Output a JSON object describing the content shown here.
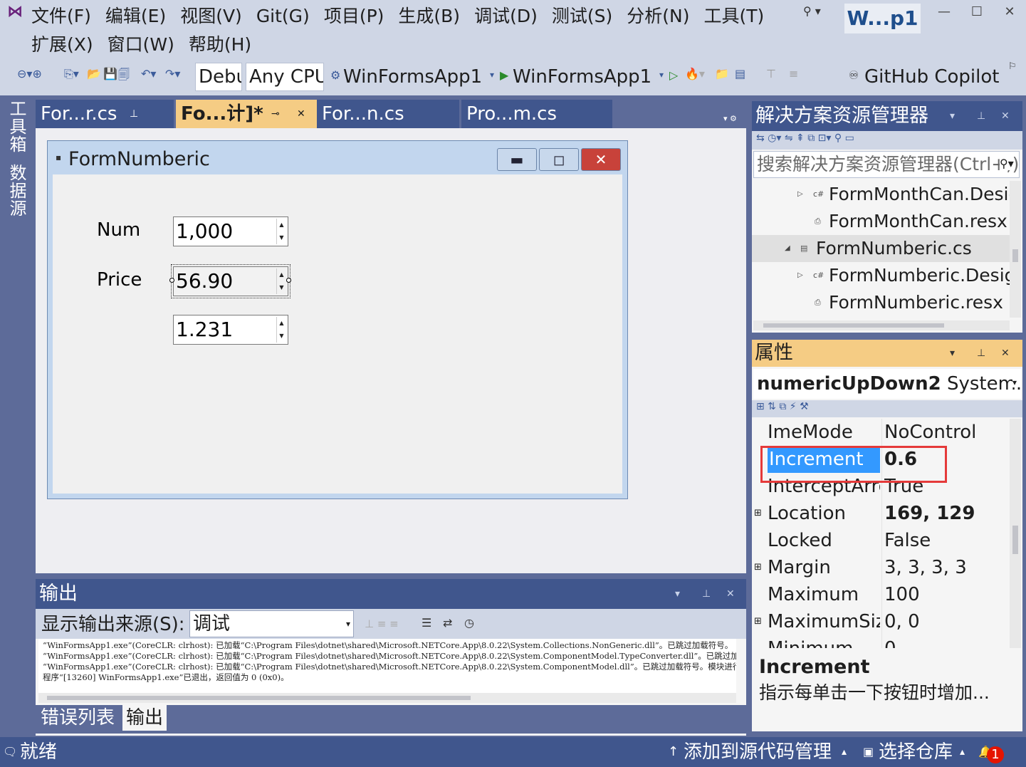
{
  "window": {
    "title": "W...p1",
    "minimize": "—",
    "maximize": "☐",
    "close": "✕"
  },
  "menu": {
    "row1": [
      "文件(F)",
      "编辑(E)",
      "视图(V)",
      "Git(G)",
      "项目(P)",
      "生成(B)",
      "调试(D)",
      "测试(S)",
      "分析(N)",
      "工具(T)"
    ],
    "row2": [
      "扩展(X)",
      "窗口(W)",
      "帮助(H)"
    ]
  },
  "toolbar": {
    "config": "Debug",
    "platform": "Any CPU",
    "startup_project": "WinFormsApp1",
    "run_target": "WinFormsApp1",
    "copilot": "GitHub Copilot"
  },
  "left_strip": {
    "toolbox": "工具箱",
    "datasource": "数据源"
  },
  "doc_tabs": [
    {
      "label": "For...r.cs",
      "active": false
    },
    {
      "label": "Fo...计]*",
      "active": true
    },
    {
      "label": "For...n.cs",
      "active": false
    },
    {
      "label": "Pro...m.cs",
      "active": false
    }
  ],
  "designer_form": {
    "title": "FormNumberic",
    "labels": {
      "num": "Num",
      "price": "Price"
    },
    "nud1": "1,000",
    "nud2": "56.90",
    "nud3": "1.231"
  },
  "output": {
    "title": "输出",
    "source_label": "显示输出来源(S):",
    "source_value": "调试",
    "lines": [
      "“WinFormsApp1.exe”(CoreCLR: clrhost): 已加载“C:\\Program Files\\dotnet\\shared\\Microsoft.NETCore.App\\8.0.22\\System.Collections.NonGeneric.dll”。已跳过加载符号。",
      "“WinFormsApp1.exe”(CoreCLR: clrhost): 已加载“C:\\Program Files\\dotnet\\shared\\Microsoft.NETCore.App\\8.0.22\\System.ComponentModel.TypeConverter.dll”。已跳过加载",
      "“WinFormsApp1.exe”(CoreCLR: clrhost): 已加载“C:\\Program Files\\dotnet\\shared\\Microsoft.NETCore.App\\8.0.22\\System.ComponentModel.dll”。已跳过加载符号。模块进行",
      "程序“[13260] WinFormsApp1.exe”已退出，返回值为 0 (0x0)。"
    ],
    "tabs": {
      "errors": "错误列表",
      "output": "输出"
    }
  },
  "solution_explorer": {
    "title": "解决方案资源管理器",
    "search_placeholder": "搜索解决方案资源管理器(Ctrl+;)",
    "items": [
      {
        "label": "FormMonthCan.Designer.cs",
        "icon": "C#"
      },
      {
        "label": "FormMonthCan.resx",
        "icon": "resx"
      },
      {
        "label": "FormNumberic.cs",
        "icon": "form"
      },
      {
        "label": "FormNumberic.Designer.cs",
        "icon": "C#"
      },
      {
        "label": "FormNumberic.resx",
        "icon": "resx"
      }
    ]
  },
  "properties": {
    "title": "属性",
    "object_name": "numericUpDown2",
    "object_type": "System.Windows.Forms.NumericUpDown",
    "rows": [
      {
        "name": "ImeMode",
        "value": "NoControl",
        "expand": "",
        "bold": false
      },
      {
        "name": "Increment",
        "value": "0.6",
        "expand": "",
        "bold": true
      },
      {
        "name": "InterceptArrowKeys",
        "value": "True",
        "expand": "",
        "bold": false
      },
      {
        "name": "Location",
        "value": "169, 129",
        "expand": "⊞",
        "bold": true
      },
      {
        "name": "Locked",
        "value": "False",
        "expand": "",
        "bold": false
      },
      {
        "name": "Margin",
        "value": "3, 3, 3, 3",
        "expand": "⊞",
        "bold": false
      },
      {
        "name": "Maximum",
        "value": "100",
        "expand": "",
        "bold": false
      },
      {
        "name": "MaximumSize",
        "value": "0, 0",
        "expand": "⊞",
        "bold": false
      },
      {
        "name": "Minimum",
        "value": "0",
        "expand": "",
        "bold": false
      }
    ],
    "desc_title": "Increment",
    "desc_text": "指示每单击一下按钮时增加..."
  },
  "status": {
    "ready": "就绪",
    "add_source": "添加到源代码管理",
    "select_repo": "选择仓库",
    "notifications": "1"
  }
}
